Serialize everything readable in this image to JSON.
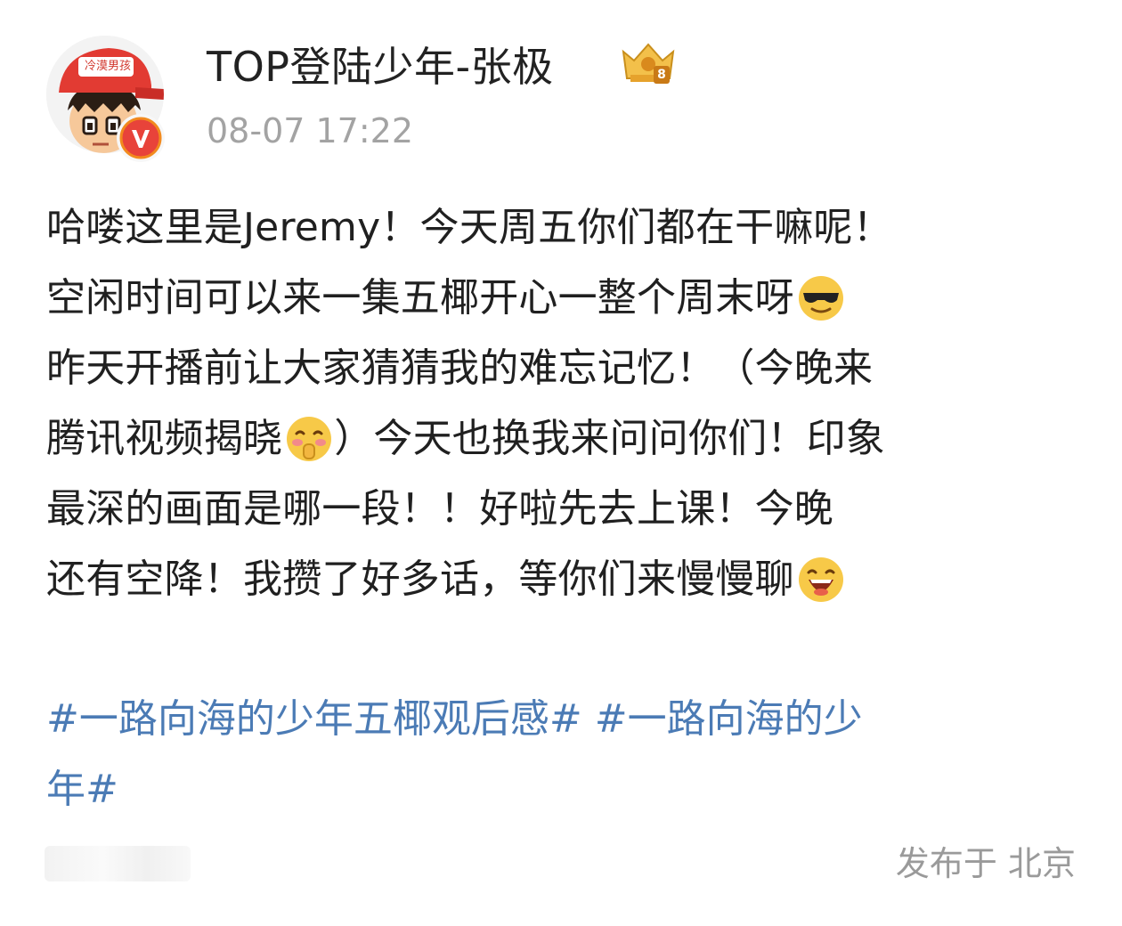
{
  "author": {
    "name": "TOP登陆少年-张极",
    "avatar_caption": "冷漠男孩",
    "avatar_icon": "cartoon-boy-red-cap-avatar",
    "verified_icon": "verified-v-icon",
    "level_badge_icon": "crown-level-badge-icon",
    "level_badge_number": "8"
  },
  "post": {
    "time": "08-07 17:22",
    "lines": [
      {
        "text": "哈喽这里是Jeremy！今天周五你们都在干嘛呢！",
        "emoji": ""
      },
      {
        "text": "空闲时间可以来一集五椰开心一整个周末呀",
        "emoji": "cool-sunglasses-emoji"
      },
      {
        "text": "昨天开播前让大家猜猜我的难忘记忆！（今晚来",
        "emoji": ""
      },
      {
        "text": "腾讯视频揭晓",
        "emoji": "shy-blush-emoji",
        "text_after": "）今天也换我来问问你们！印象"
      },
      {
        "text": "最深的画面是哪一段！！好啦先去上课！今晚",
        "emoji": ""
      },
      {
        "text": "还有空降！我攒了好多话，等你们来慢慢聊",
        "emoji": "laughing-emoji"
      }
    ],
    "topic_line_1": "#一路向海的少年五椰观后感# #一路向海的少",
    "topic_line_2": "年#",
    "location": "发布于 北京"
  },
  "colors": {
    "topic": "#4b7bb5",
    "meta": "#a3a3a3",
    "body": "#202020",
    "verified": "#e8433a"
  }
}
